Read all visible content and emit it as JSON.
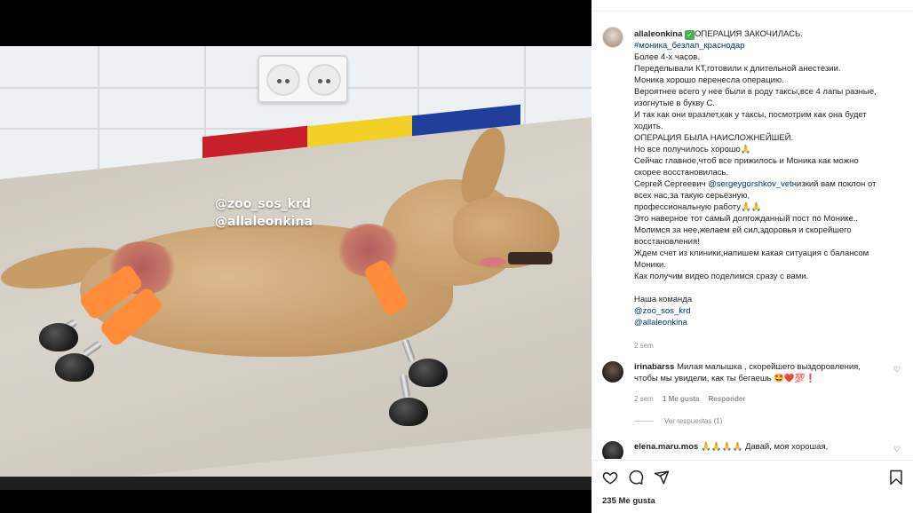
{
  "photo": {
    "watermarks": [
      "@zoo_sos_krd",
      "@allaleonkina"
    ]
  },
  "post": {
    "username": "allaleonkina",
    "headline": "ОПЕРАЦИЯ ЗАКОЧИЛАСЬ.",
    "hashtag": "#моника_безлап_краснодар",
    "lines": [
      "Более 4-х часов.",
      "Переделывали КТ,готовили к длительной анестезии.",
      "Моника хорошо перенесла операцию.",
      "Вероятнее всего у нее были в роду таксы,все 4 лапы разные,",
      "изогнутые в букву С.",
      "И так как они вразлет,как у таксы, посмотрим как она будет",
      "ходить.",
      "ОПЕРАЦИЯ БЫЛА НАИСЛОЖНЕЙШЕЙ.",
      "Но все получилось хорошо🙏",
      "Сейчас главное,чтоб все прижилось и Моника как можно",
      "скорее восстановилась."
    ],
    "mention_prefix": "Сергей Сергеевич ",
    "mention": "@sergeygorshkov_vet",
    "mention_suffix": "низкий вам поклон от",
    "lines2": [
      "всех нас,за такую серьезную,",
      "профессиональную работу🙏🙏",
      "Это наверное тот самый долгожданный пост по Монике..",
      "Молимся за нее,желаем ей сил,здоровья и скорейшего",
      "восстановления!",
      "Ждем счет из клиники,напишем какая ситуация с балансом",
      "Моники.",
      "Как получим видео поделимся сразу с вами."
    ],
    "team_label": "Наша команда",
    "team_links": [
      "@zoo_sos_krd",
      "@allaleonkina"
    ],
    "time": "2 sem"
  },
  "comments": [
    {
      "username": "irinabarss",
      "text_line1": "Милая малышка , скорейшего выздоровления,",
      "text_line2": "чтобы мы увидели, как ты бегаешь 🤩❤️💯❗",
      "time": "2 sem",
      "likes": "1 Me gusta",
      "reply": "Responder",
      "view_replies": "Ver respuestas (1)"
    },
    {
      "username": "elena.maru.mos",
      "text_line1": "🙏🙏🙏🙏 Давай, моя хорошая,"
    }
  ],
  "actions": {
    "like_icon": "heart-icon",
    "comment_icon": "comment-icon",
    "share_icon": "share-icon",
    "save_icon": "bookmark-icon",
    "likes_count": "235 Me gusta"
  }
}
